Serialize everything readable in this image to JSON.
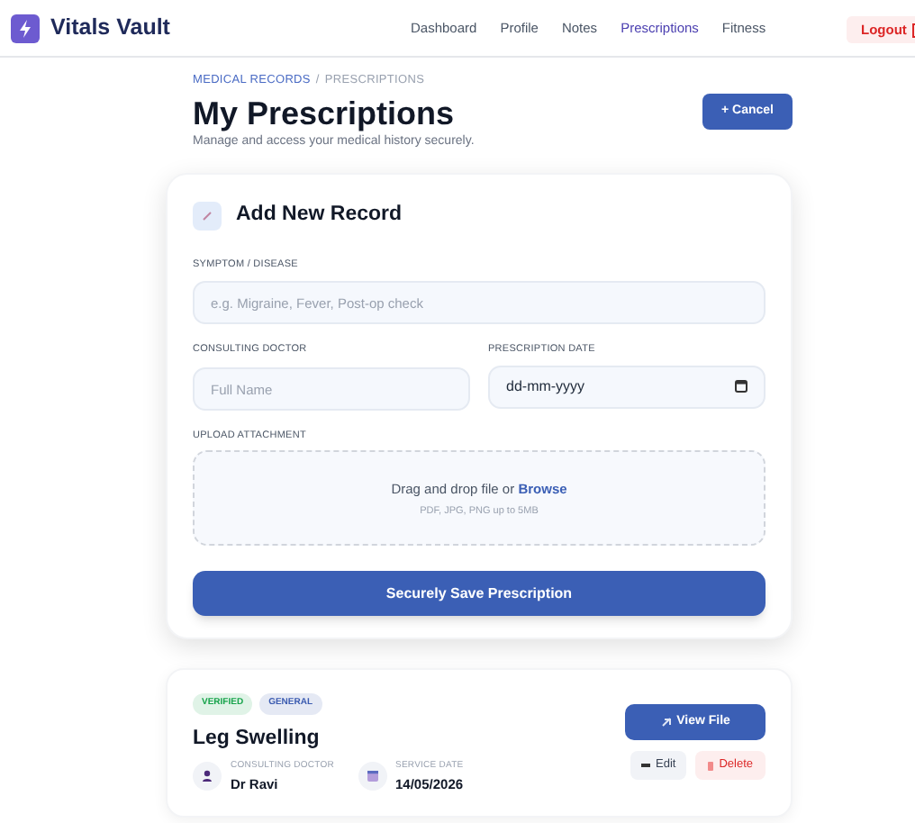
{
  "brand": "Vitals Vault",
  "nav": [
    {
      "label": "Dashboard",
      "selected": false
    },
    {
      "label": "Profile",
      "selected": false
    },
    {
      "label": "Notes",
      "selected": false
    },
    {
      "label": "Prescriptions",
      "selected": true
    },
    {
      "label": "Fitness",
      "selected": false
    }
  ],
  "logout": "Logout",
  "breadcrumb": {
    "section": "MEDICAL RECORDS",
    "separator": "/",
    "page": "PRESCRIPTIONS"
  },
  "title": "My Prescriptions",
  "subtitle": "Manage and access your medical history securely.",
  "cancel_button": "+ Cancel",
  "form": {
    "title": "Add New Record",
    "symptom": {
      "label": "SYMPTOM / DISEASE",
      "placeholder": "e.g. Migraine, Fever, Post-op check"
    },
    "doctor": {
      "label": "CONSULTING DOCTOR",
      "placeholder": "Full Name"
    },
    "date": {
      "label": "PRESCRIPTION DATE",
      "value": "dd-mm-yyyy"
    },
    "upload": {
      "label": "UPLOAD ATTACHMENT",
      "text": "Drag and drop file or",
      "link": "Browse",
      "hint": "PDF, JPG, PNG up to 5MB"
    },
    "submit": "Securely Save Prescription"
  },
  "records": [
    {
      "tags": [
        {
          "label": "VERIFIED",
          "color": "#16a34a"
        },
        {
          "label": "GENERAL",
          "color": "#3b5bb0"
        }
      ],
      "title": "Leg Swelling",
      "doctor_label": "CONSULTING DOCTOR",
      "doctor": "Dr Ravi",
      "date_label": "SERVICE DATE",
      "date": "14/05/2026",
      "view": "View File",
      "edit": "Edit",
      "delete": "Delete"
    }
  ]
}
